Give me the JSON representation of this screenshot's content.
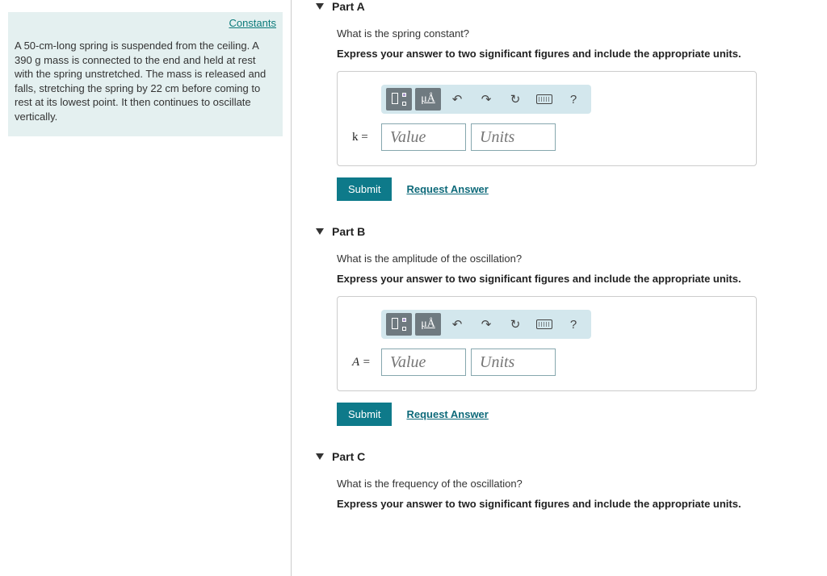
{
  "left": {
    "constants_label": "Constants",
    "problem": "A 50-cm-long spring is suspended from the ceiling. A 390 g mass is connected to the end and held at rest with the spring unstretched. The mass is released and falls, stretching the spring by 22 cm before coming to rest at its lowest point. It then continues to oscillate vertically."
  },
  "toolbar": {
    "mu_a": "μÅ",
    "help": "?"
  },
  "parts": {
    "a": {
      "title": "Part A",
      "question": "What is the spring constant?",
      "instruction": "Express your answer to two significant figures and include the appropriate units.",
      "var": "k =",
      "value_ph": "Value",
      "units_ph": "Units",
      "submit": "Submit",
      "request": "Request Answer"
    },
    "b": {
      "title": "Part B",
      "question": "What is the amplitude of the oscillation?",
      "instruction": "Express your answer to two significant figures and include the appropriate units.",
      "var": "A =",
      "value_ph": "Value",
      "units_ph": "Units",
      "submit": "Submit",
      "request": "Request Answer"
    },
    "c": {
      "title": "Part C",
      "question": "What is the frequency of the oscillation?",
      "instruction": "Express your answer to two significant figures and include the appropriate units."
    }
  }
}
